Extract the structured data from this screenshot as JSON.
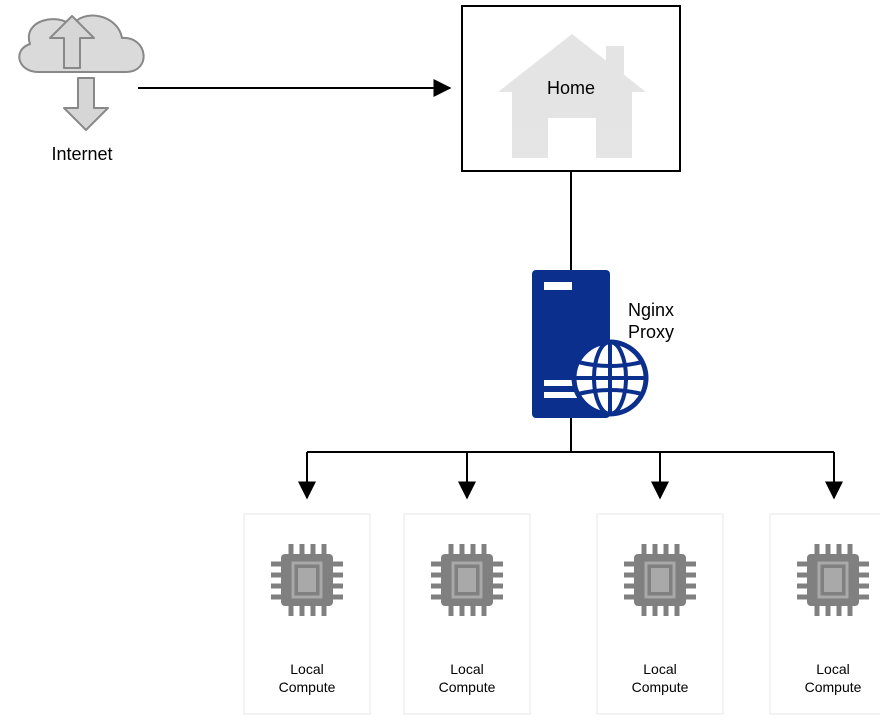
{
  "nodes": {
    "internet": {
      "label": "Internet"
    },
    "home": {
      "label": "Home"
    },
    "proxy": {
      "label_line1": "Nginx",
      "label_line2": "Proxy"
    },
    "compute": {
      "label_line1": "Local",
      "label_line2": "Compute",
      "items": [
        {
          "label_line1": "Local",
          "label_line2": "Compute"
        },
        {
          "label_line1": "Local",
          "label_line2": "Compute"
        },
        {
          "label_line1": "Local",
          "label_line2": "Compute"
        },
        {
          "label_line1": "Local",
          "label_line2": "Compute"
        }
      ]
    }
  },
  "edges": [
    {
      "from": "internet",
      "to": "home"
    },
    {
      "from": "home",
      "to": "proxy"
    },
    {
      "from": "proxy",
      "to": "compute[0]"
    },
    {
      "from": "proxy",
      "to": "compute[1]"
    },
    {
      "from": "proxy",
      "to": "compute[2]"
    },
    {
      "from": "proxy",
      "to": "compute[3]"
    }
  ],
  "colors": {
    "cloud_fill": "#dadada",
    "cloud_stroke": "#888888",
    "arrow_body_fill": "#d6d6d6",
    "server_fill": "#0b2f8c",
    "globe_stroke": "#0b2f8c",
    "chip_fill": "#808080",
    "box_stroke": "#e7e7e7",
    "conn_stroke": "#000000"
  }
}
